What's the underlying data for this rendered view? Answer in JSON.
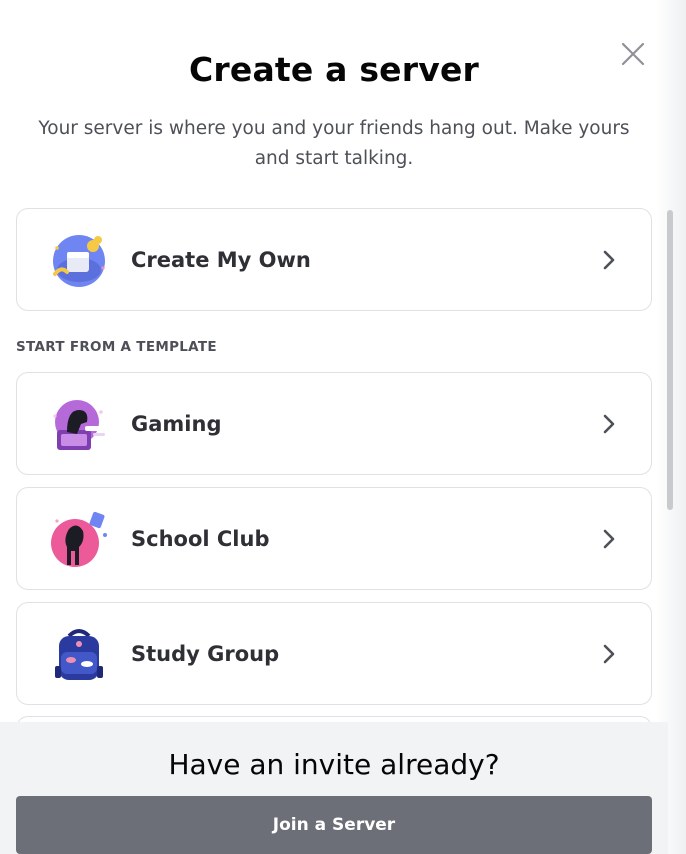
{
  "modal": {
    "title": "Create a server",
    "subtitle": "Your server is where you and your friends hang out. Make yours and start talking.",
    "close_icon": "close-icon"
  },
  "create_own": {
    "label": "Create My Own",
    "icon": "create-own-illustration-icon"
  },
  "template_section": {
    "label": "START FROM A TEMPLATE",
    "templates": [
      {
        "label": "Gaming",
        "icon": "gaming-illustration-icon"
      },
      {
        "label": "School Club",
        "icon": "school-club-illustration-icon"
      },
      {
        "label": "Study Group",
        "icon": "study-group-illustration-icon"
      }
    ]
  },
  "footer": {
    "title": "Have an invite already?",
    "join_label": "Join a Server"
  },
  "colors": {
    "card_border": "#dfe1e5",
    "footer_bg": "#f2f3f5",
    "join_button": "#6d6f78",
    "text_primary": "#060607",
    "text_muted": "#4e5058"
  }
}
